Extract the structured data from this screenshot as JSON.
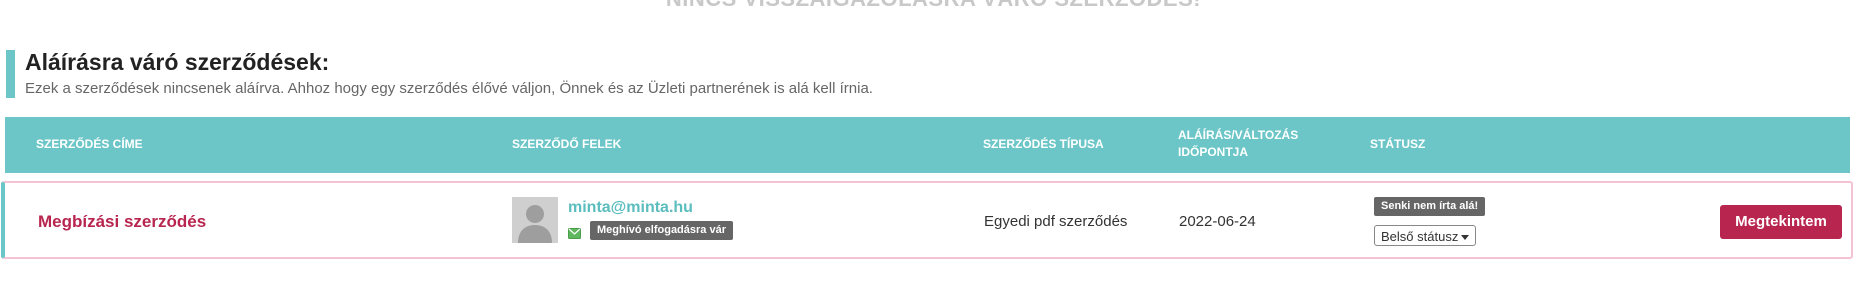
{
  "top_message": "NINCS VISSZAIGAZOLÁSRA VÁRÓ SZERZŐDÉS!",
  "section": {
    "title": "Aláírásra váró szerződések:",
    "description": "Ezek a szerződések nincsenek aláírva. Ahhoz hogy egy szerződés élővé váljon, Önnek és az Üzleti partnerének is alá kell írnia."
  },
  "table": {
    "headers": {
      "title": "SZERZŐDÉS CÍME",
      "parties": "SZERZŐDŐ FELEK",
      "type": "SZERZŐDÉS TÍPUSA",
      "date_line1": "ALÁÍRÁS/VÁLTOZÁS",
      "date_line2": "IDŐPONTJA",
      "status": "STÁTUSZ"
    },
    "rows": [
      {
        "title": "Megbízási szerződés",
        "party_email": "minta@minta.hu",
        "invite_badge": "Meghívó elfogadásra vár",
        "type": "Egyedi pdf szerződés",
        "date": "2022-06-24",
        "status_badge": "Senki nem írta alá!",
        "internal_status": "Belső státusz",
        "view_button": "Megtekintem"
      }
    ]
  },
  "colors": {
    "accent_teal": "#6cc6c7",
    "brand_crimson": "#b8264f",
    "badge_gray": "#666666"
  },
  "icons": {
    "envelope": "envelope-icon",
    "avatar": "default-user-avatar"
  }
}
